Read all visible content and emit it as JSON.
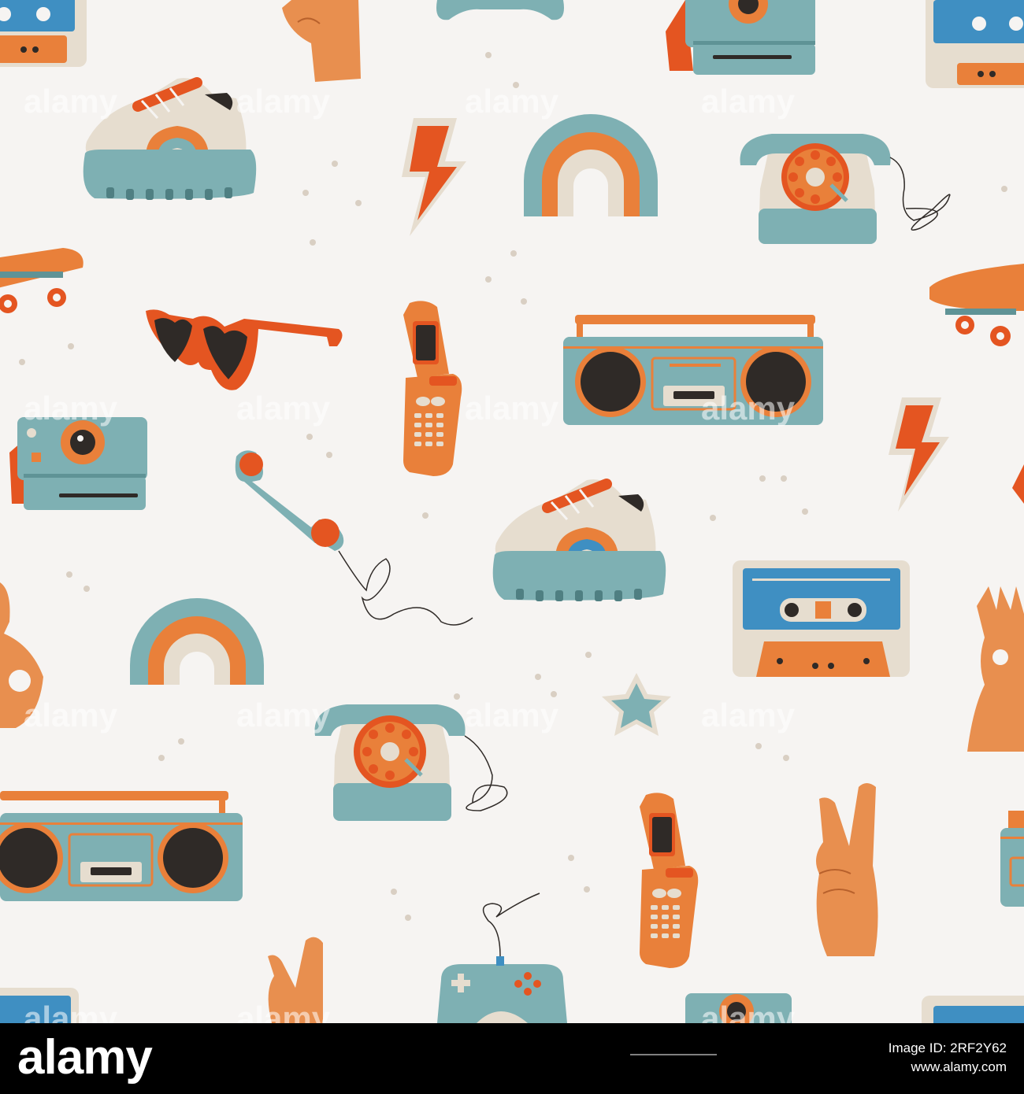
{
  "watermark": {
    "text": "alamy"
  },
  "colors": {
    "background": "#f6f4f2",
    "teal": "#7eb0b3",
    "orange": "#e9803a",
    "red_orange": "#e45521",
    "cream": "#e6ddcf",
    "dark": "#2f2a27",
    "skin": "#e88f4f"
  },
  "footer": {
    "brand": "alamy",
    "image_id_label": "Image ID: 2RF2Y62",
    "site": "www.alamy.com"
  },
  "icons": [
    "cassette-icon",
    "hand-icon",
    "game-controller-icon",
    "instant-camera-icon",
    "sneaker-icon",
    "lightning-bolt-icon",
    "rainbow-icon",
    "rotary-phone-icon",
    "skateboard-icon",
    "heart-sunglasses-icon",
    "flip-phone-icon",
    "boombox-icon",
    "phone-handset-icon",
    "star-icon",
    "peace-sign-hand-icon",
    "ok-hand-icon"
  ]
}
